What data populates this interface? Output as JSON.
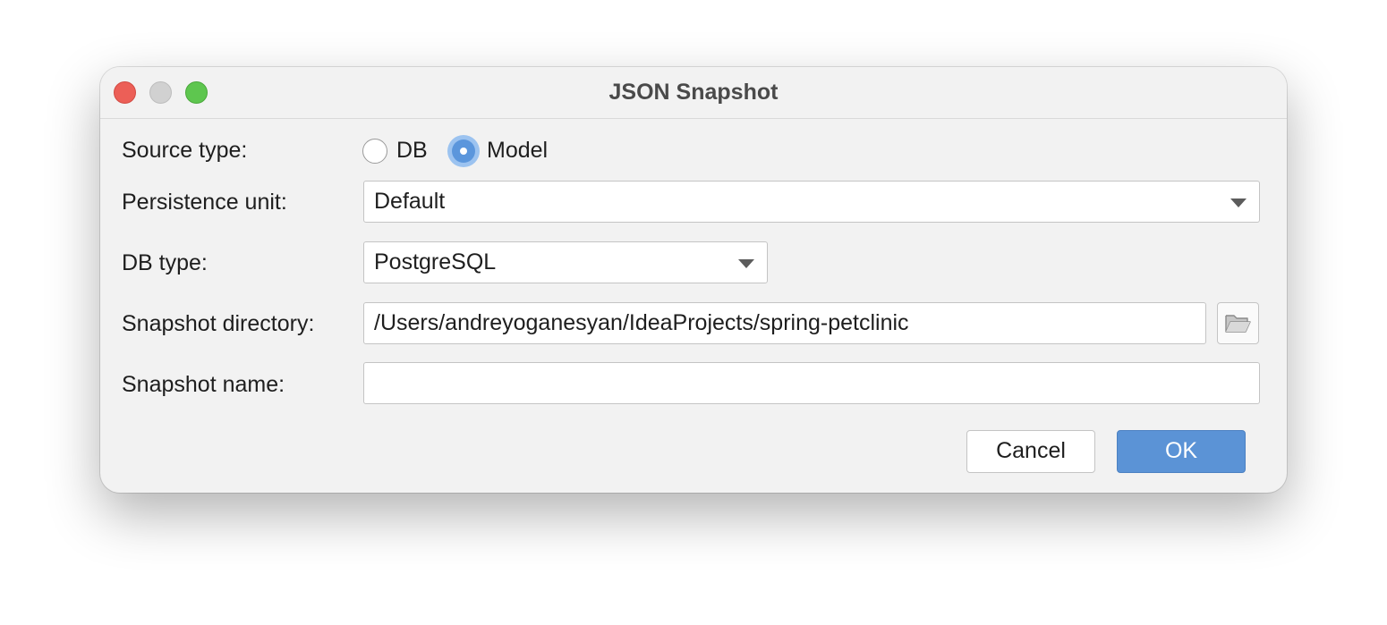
{
  "dialog": {
    "title": "JSON Snapshot"
  },
  "form": {
    "source_type": {
      "label": "Source type:",
      "options": [
        "DB",
        "Model"
      ],
      "selected": "Model"
    },
    "persistence_unit": {
      "label": "Persistence unit:",
      "value": "Default"
    },
    "db_type": {
      "label": "DB type:",
      "value": "PostgreSQL"
    },
    "snapshot_directory": {
      "label": "Snapshot directory:",
      "value": "/Users/andreyoganesyan/IdeaProjects/spring-petclinic"
    },
    "snapshot_name": {
      "label": "Snapshot name:",
      "value": ""
    }
  },
  "buttons": {
    "cancel": "Cancel",
    "ok": "OK"
  },
  "icons": {
    "browse": "folder-icon",
    "dropdown": "chevron-down-icon"
  },
  "colors": {
    "accent": "#5b93d6",
    "close": "#ec5f57",
    "minimize": "#d1d1d1",
    "zoom": "#5ec64f"
  }
}
